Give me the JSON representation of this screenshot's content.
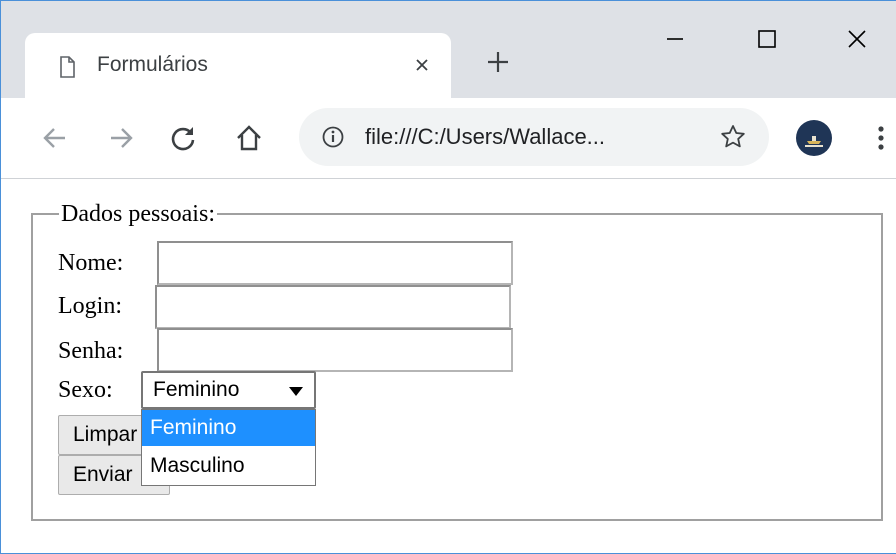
{
  "browser": {
    "tab": {
      "title": "Formulários",
      "icon": "document-icon"
    },
    "controls": [
      "minimize",
      "maximize",
      "close"
    ],
    "address": {
      "url": "file:///C:/Users/Wallace...",
      "info_icon": "info-icon",
      "bookmark_icon": "star-icon"
    },
    "nav_icons": [
      "back-arrow-icon",
      "forward-arrow-icon",
      "reload-icon",
      "home-icon"
    ]
  },
  "form": {
    "legend": "Dados pessoais:",
    "nome_label": "Nome:",
    "nome_value": "",
    "login_label": "Login:",
    "login_value": "",
    "senha_label": "Senha:",
    "senha_value": "",
    "sexo_label": "Sexo:",
    "sexo_selected": "Feminino",
    "sexo_options": [
      "Feminino",
      "Masculino"
    ],
    "limpar_label": "Limpar",
    "enviar_label": "Enviar"
  },
  "colors": {
    "selection": "#1e90ff",
    "tabbar": "#dee1e6",
    "omnibox": "#f1f3f4"
  }
}
